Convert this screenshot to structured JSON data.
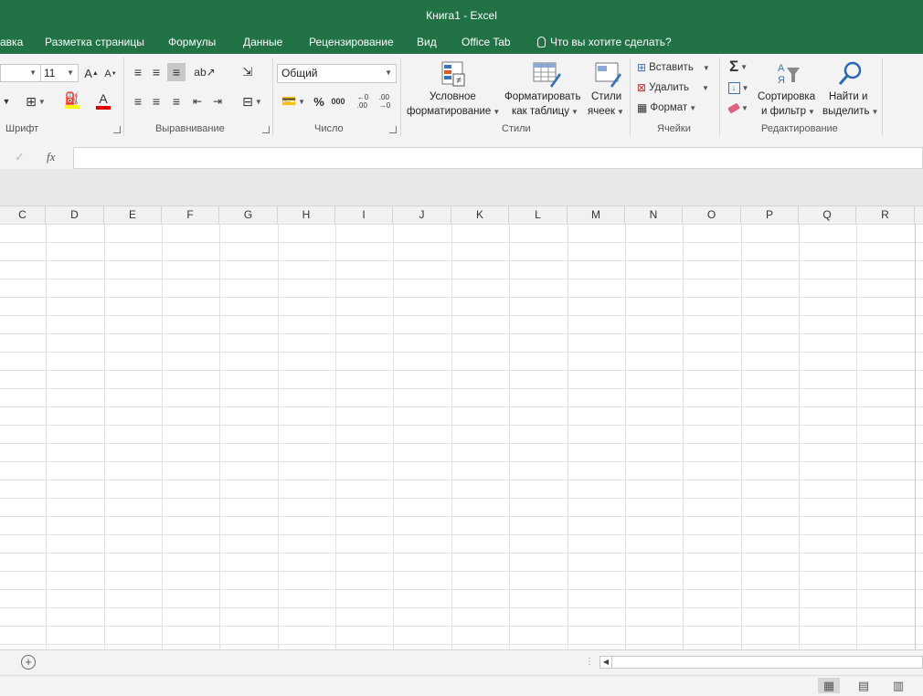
{
  "window": {
    "title": "Книга1 - Excel"
  },
  "tabs": [
    {
      "label": "авка"
    },
    {
      "label": "Разметка страницы"
    },
    {
      "label": "Формулы"
    },
    {
      "label": "Данные"
    },
    {
      "label": "Рецензирование"
    },
    {
      "label": "Вид"
    },
    {
      "label": "Office Tab"
    }
  ],
  "tell_me": {
    "label": "Что вы хотите сделать?"
  },
  "ribbon": {
    "font": {
      "size": "11",
      "group_label": "Шрифт"
    },
    "alignment": {
      "group_label": "Выравнивание"
    },
    "number": {
      "format": "Общий",
      "group_label": "Число",
      "percent": "%",
      "thousands": "000"
    },
    "styles": {
      "group_label": "Стили",
      "conditional": [
        "Условное",
        "форматирование"
      ],
      "as_table": [
        "Форматировать",
        "как таблицу"
      ],
      "cell_styles": [
        "Стили",
        "ячеек"
      ]
    },
    "cells": {
      "group_label": "Ячейки",
      "insert": "Вставить",
      "delete": "Удалить",
      "format": "Формат"
    },
    "editing": {
      "group_label": "Редактирование",
      "sort": [
        "Сортировка",
        "и фильтр"
      ],
      "find": [
        "Найти и",
        "выделить"
      ]
    }
  },
  "formula_bar": {
    "fx": "fx",
    "value": ""
  },
  "columns": [
    "C",
    "D",
    "E",
    "F",
    "G",
    "H",
    "I",
    "J",
    "K",
    "L",
    "M",
    "N",
    "O",
    "P",
    "Q",
    "R"
  ],
  "colors": {
    "brand": "#217346",
    "ribbon": "#f3f3f3",
    "gridline": "#e1e1e1"
  }
}
